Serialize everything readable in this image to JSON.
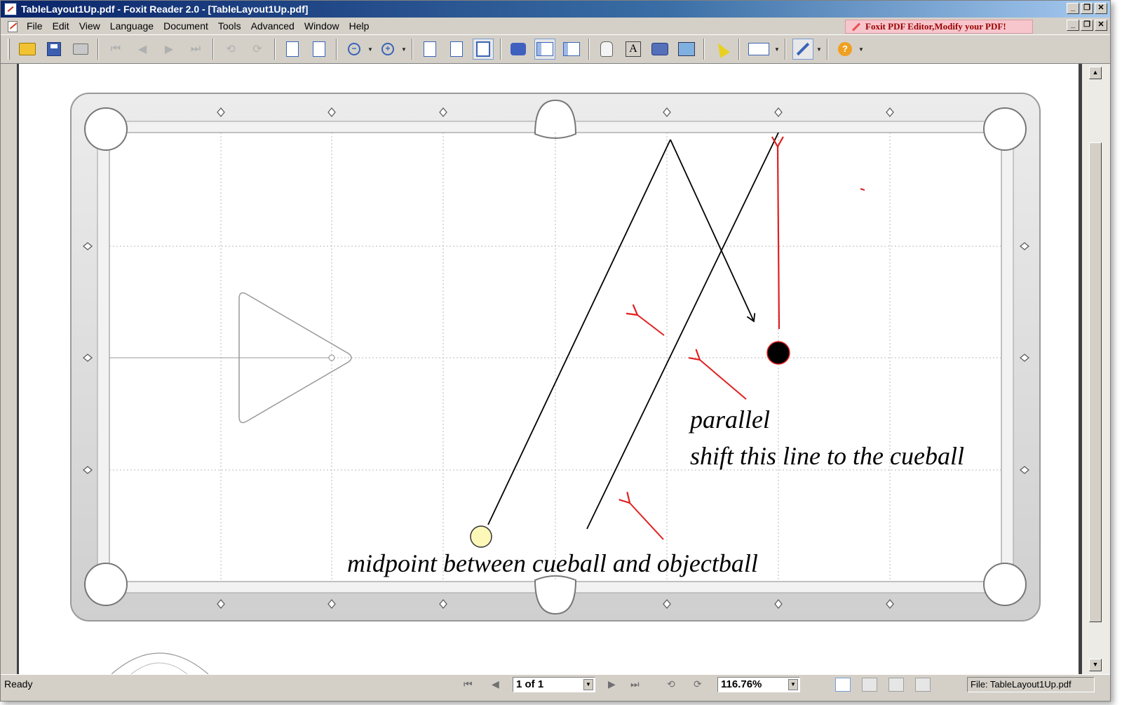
{
  "window": {
    "title": "TableLayout1Up.pdf - Foxit Reader 2.0 - [TableLayout1Up.pdf]",
    "buttons": {
      "minimize": "_",
      "restore": "❐",
      "close": "✕"
    }
  },
  "menu": {
    "items": [
      "File",
      "Edit",
      "View",
      "Language",
      "Document",
      "Tools",
      "Advanced",
      "Window",
      "Help"
    ],
    "promo": "Foxit PDF Editor,Modify your PDF!"
  },
  "toolbar": {
    "icons": [
      "open-icon",
      "save-icon",
      "print-icon",
      "first-page-icon",
      "prev-page-icon",
      "next-page-icon",
      "last-page-icon",
      "back-icon",
      "forward-icon",
      "single-page-icon",
      "facing-page-icon",
      "zoom-out-icon",
      "zoom-in-icon",
      "actual-size-icon",
      "fit-page-icon",
      "fit-width-icon",
      "find-icon",
      "bookmarks-icon",
      "thumbnail-icon",
      "hand-icon",
      "text-select-icon",
      "snapshot-icon",
      "image-icon",
      "select-icon",
      "measure-icon",
      "arrow-tool-icon",
      "help-icon"
    ]
  },
  "document": {
    "annotations": {
      "parallel": "parallel",
      "shift": "shift this line to the cueball",
      "midpoint": "midpoint between cueball and objectball"
    },
    "colors": {
      "table_rail": "#d8d8d8",
      "cueball": "#fdf8b8",
      "objectball": "#000000",
      "annotation_red": "#e02020"
    }
  },
  "statusbar": {
    "status": "Ready",
    "page": "1 of 1",
    "zoom": "116.76%",
    "file": "File: TableLayout1Up.pdf"
  }
}
